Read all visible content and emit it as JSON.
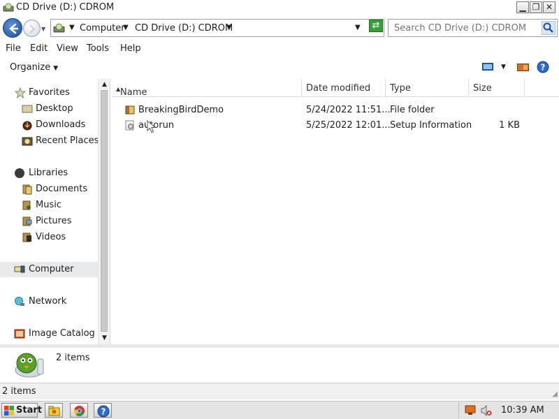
{
  "window": {
    "title": "CD Drive (D:) CDROM",
    "minimize_glyph": "▁",
    "maximize_glyph": "❐",
    "close_glyph": "✕"
  },
  "address": {
    "crumbs": [
      "Computer",
      "CD Drive (D:) CDROM"
    ],
    "search_placeholder": "Search CD Drive (D:) CDROM"
  },
  "menu": {
    "items": [
      "File",
      "Edit",
      "View",
      "Tools",
      "Help"
    ]
  },
  "command": {
    "organize_label": "Organize"
  },
  "nav": {
    "favorites": "Favorites",
    "desktop": "Desktop",
    "downloads": "Downloads",
    "recent": "Recent Places",
    "libraries": "Libraries",
    "documents": "Documents",
    "music": "Music",
    "pictures": "Pictures",
    "videos": "Videos",
    "computer": "Computer",
    "network": "Network",
    "image_catalog": "Image Catalog"
  },
  "columns": {
    "name": "Name",
    "date": "Date modified",
    "type": "Type",
    "size": "Size"
  },
  "files": [
    {
      "name": "BreakingBirdDemo",
      "date": "5/24/2022 11:51...",
      "type": "File folder",
      "size": "",
      "icon": "folder-icon"
    },
    {
      "name": "autorun",
      "date": "5/25/2022 12:01...",
      "type": "Setup Information",
      "size": "1 KB",
      "icon": "setup-file-icon"
    }
  ],
  "details": {
    "count": "2 items"
  },
  "status": {
    "text": "2 items"
  },
  "taskbar": {
    "start_label": "Start",
    "clock": "10:39 AM"
  },
  "colors": {
    "accent": "#1f4f9a",
    "refresh_green": "#3a9d3a",
    "help_blue": "#2b6cc4"
  }
}
